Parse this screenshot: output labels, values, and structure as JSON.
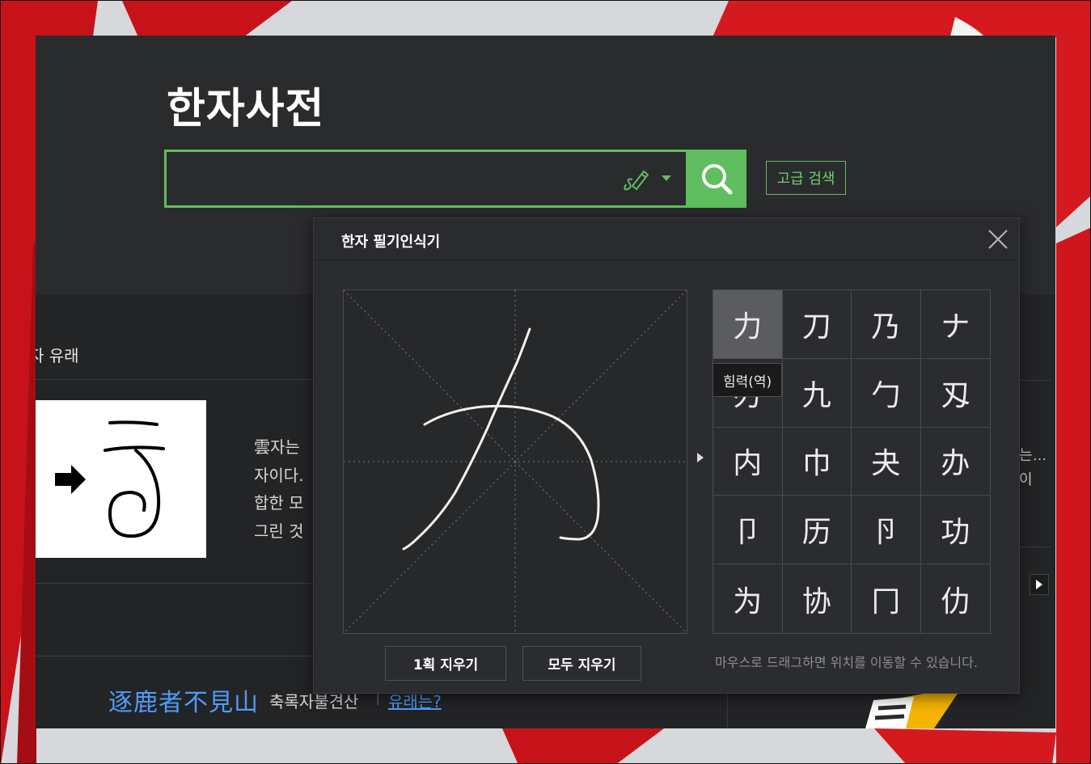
{
  "page": {
    "title": "한자사전",
    "search": {
      "value": "",
      "placeholder": ""
    },
    "advanced_search_label": "고급 검색",
    "origin_heading": "자 유래",
    "origin_description": [
      "雲자는",
      "자이다.",
      "합한 모",
      "그린 것"
    ],
    "idiom": {
      "hanja": "逐鹿者不見山",
      "reading": "축록자불견산",
      "separator": "|",
      "link": "유래는?"
    },
    "right_panel_text": [
      "는…",
      "이"
    ]
  },
  "handwriting_popup": {
    "title": "한자 필기인식기",
    "candidates": [
      "力",
      "刀",
      "乃",
      "ナ",
      "刃",
      "九",
      "勹",
      "刄",
      "内",
      "巾",
      "夬",
      "办",
      "卩",
      "历",
      "卪",
      "功",
      "为",
      "协",
      "冂",
      "仂"
    ],
    "selected_index": 0,
    "tooltip": "힘력(역)",
    "buttons": {
      "undo_stroke": "1획 지우기",
      "clear_all": "모두 지우기"
    },
    "hint": "마우스로 드래그하면 위치를 이동할 수 있습니다."
  },
  "colors": {
    "accent_green": "#5fbe5e",
    "link_blue": "#4f9cf7",
    "window_bg": "#2a2b2d"
  }
}
